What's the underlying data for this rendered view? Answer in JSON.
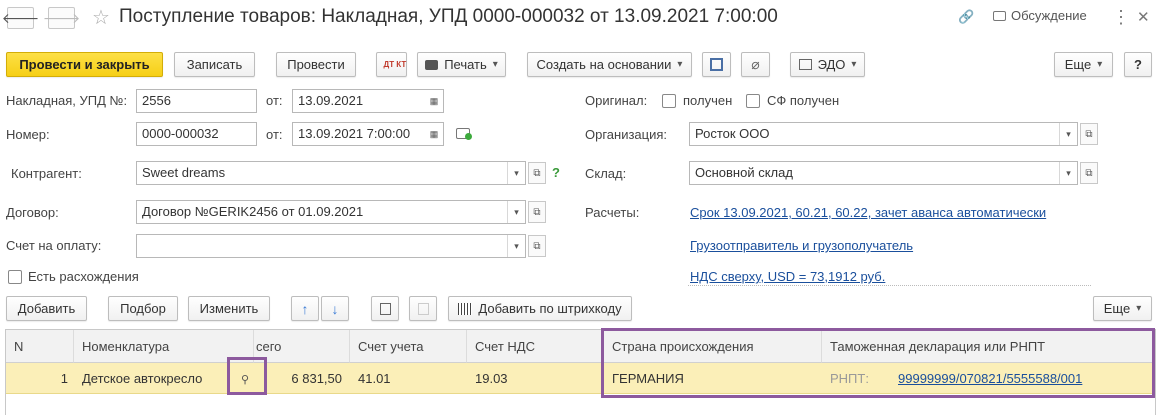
{
  "header": {
    "title": "Поступление товаров: Накладная, УПД 0000-000032 от 13.09.2021 7:00:00",
    "discussion": "Обсуждение",
    "back_glyph": "🡐",
    "forward_glyph": "🡒",
    "star_glyph": "☆",
    "link_glyph": "🔗",
    "more_glyph": "⋮",
    "close_glyph": "✕"
  },
  "toolbar": {
    "post_close": "Провести и закрыть",
    "save": "Записать",
    "post": "Провести",
    "dtkt": "ДТ КТ",
    "print": "Печать",
    "create_based": "Создать на основании",
    "edo": "ЭДО",
    "more": "Еще",
    "help": "?"
  },
  "form": {
    "invoice_label": "Накладная, УПД №:",
    "invoice_no": "2556",
    "from_label": "от:",
    "invoice_date": "13.09.2021",
    "number_label": "Номер:",
    "number": "0000-000032",
    "number_date": "13.09.2021  7:00:00",
    "counterparty_label": "Контрагент:",
    "counterparty": "Sweet dreams",
    "question": "?",
    "contract_label": "Договор:",
    "contract": "Договор №GERIK2456 от 01.09.2021",
    "invoice_pay_label": "Счет на оплату:",
    "invoice_pay": "",
    "discrepancy_label": "Есть расхождения",
    "original_label": "Оригинал:",
    "received_label": "получен",
    "sf_received_label": "СФ получен",
    "org_label": "Организация:",
    "org": "Росток ООО",
    "warehouse_label": "Склад:",
    "warehouse": "Основной склад",
    "settlements_label": "Расчеты:",
    "settlements_link": "Срок 13.09.2021, 60.21, 60.22, зачет аванса автоматически",
    "shipper_link": "Грузоотправитель и грузополучатель",
    "vat_link": "НДС сверху, USD = 73,1912 руб."
  },
  "table_toolbar": {
    "add": "Добавить",
    "pick": "Подбор",
    "change": "Изменить",
    "add_barcode": "Добавить по штрихкоду",
    "more": "Еще"
  },
  "table": {
    "columns": [
      "N",
      "Номенклатура",
      "сего",
      "Счет учета",
      "Счет НДС",
      "Страна происхождения",
      "Таможенная декларация или РНПТ"
    ],
    "rows": [
      {
        "n": "1",
        "item": "Детское автокресло",
        "total": "6 831,50",
        "account": "41.01",
        "vat_account": "19.03",
        "country": "ГЕРМАНИЯ",
        "rnpt_label": "РНПТ:",
        "rnpt": "99999999/070821/5555588/001"
      }
    ]
  },
  "colors": {
    "primary": "#f6cf16",
    "row_highlight": "#fbefb8",
    "frame": "#8d5a9e",
    "link": "#1a4f9c"
  }
}
